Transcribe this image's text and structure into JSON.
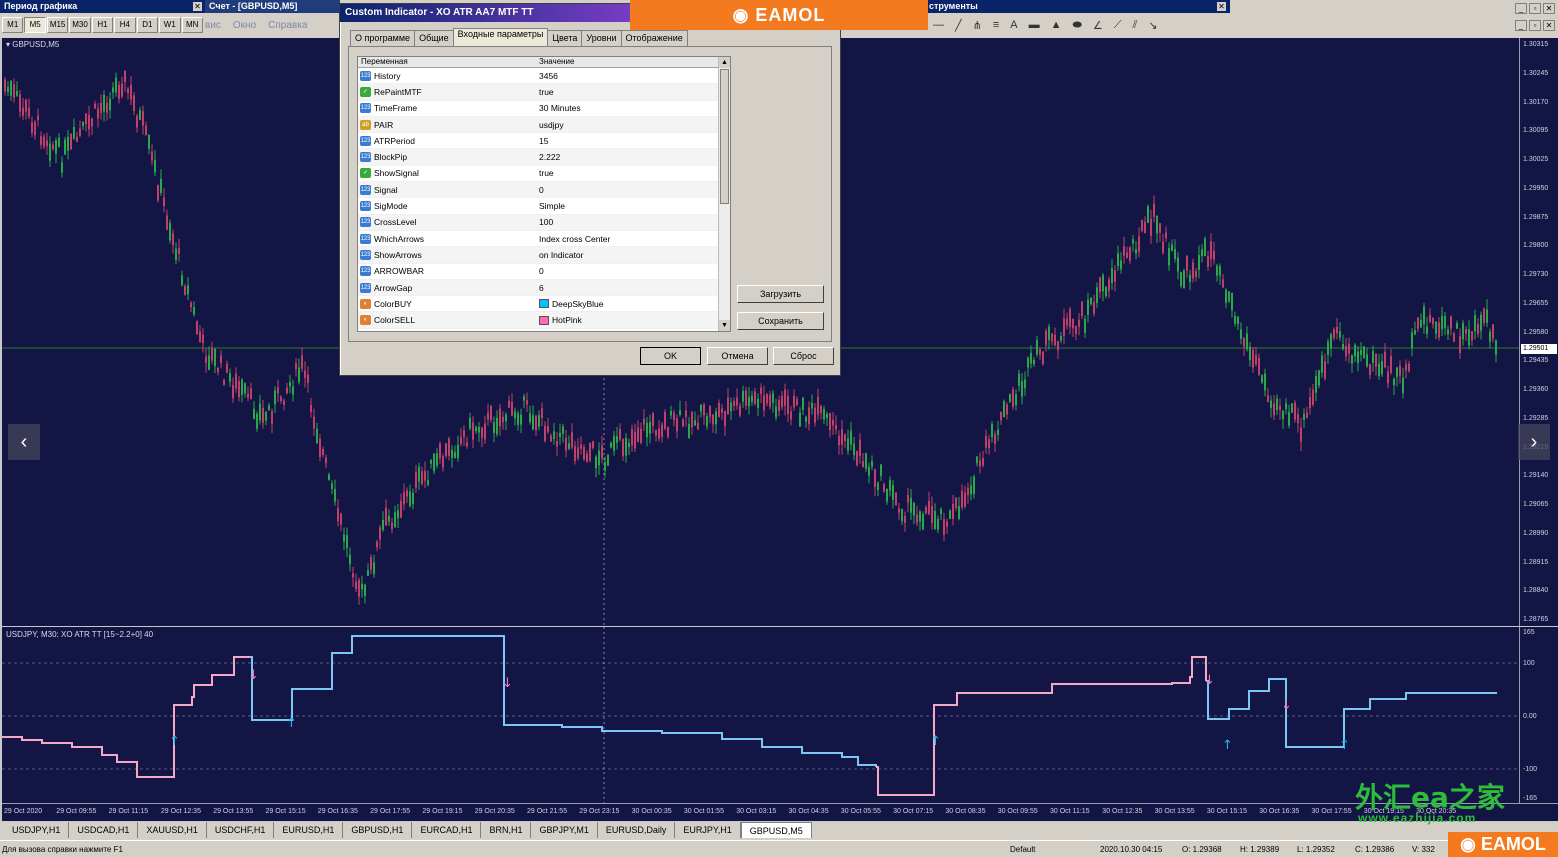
{
  "top": {
    "period_title": "Период графика",
    "chart_title": "Счет - [GBPUSD,M5]",
    "tools_title": "струменты",
    "periods": [
      "M1",
      "M5",
      "M15",
      "M30",
      "H1",
      "H4",
      "D1",
      "W1",
      "MN"
    ],
    "active_period": "M5",
    "menu": [
      "вис",
      "Окно",
      "Справка"
    ]
  },
  "chart": {
    "symbol_label": "GBPUSD,M5",
    "current_price": "1.29501",
    "price_ticks": [
      "1.30315",
      "1.30245",
      "1.30170",
      "1.30095",
      "1.30025",
      "1.29950",
      "1.29875",
      "1.29800",
      "1.29730",
      "1.29655",
      "1.29580",
      "1.29435",
      "1.29360",
      "1.29285",
      "1.29215",
      "1.29140",
      "1.29065",
      "1.28990",
      "1.28915",
      "1.28840",
      "1.28765"
    ],
    "indicator_label": "USDJPY, M30: XO ATR TT [15~2.2+0] 40",
    "ind_ticks": [
      "165",
      "100",
      "0.00",
      "-100",
      "-165"
    ],
    "time_ticks": [
      "29 Oct 2020",
      "29 Oct 09:55",
      "29 Oct 11:15",
      "29 Oct 12:35",
      "29 Oct 13:55",
      "29 Oct 15:15",
      "29 Oct 16:35",
      "29 Oct 17:55",
      "29 Oct 19:15",
      "29 Oct 20:35",
      "29 Oct 21:55",
      "29 Oct 23:15",
      "30 Oct 00:35",
      "30 Oct 01:55",
      "30 Oct 03:15",
      "30 Oct 04:35",
      "30 Oct 05:55",
      "30 Oct 07:15",
      "30 Oct 08:35",
      "30 Oct 09:55",
      "30 Oct 11:15",
      "30 Oct 12:35",
      "30 Oct 13:55",
      "30 Oct 15:15",
      "30 Oct 16:35",
      "30 Oct 17:55",
      "30 Oct 19:15",
      "30 Oct 20:35"
    ],
    "colors": {
      "bg": "#131644",
      "bull": "#2aa84a",
      "bear": "#c0406a",
      "buy": "#22b8f0",
      "sell": "#f07ab8",
      "line_up": "#7cc6f4",
      "line_dn": "#f4a8c8"
    }
  },
  "dialog": {
    "title": "Custom Indicator - XO ATR AA7 MTF TT",
    "tabs": [
      "О программе",
      "Общие",
      "Входные параметры",
      "Цвета",
      "Уровни",
      "Отображение"
    ],
    "active_tab": "Входные параметры",
    "col_var": "Переменная",
    "col_val": "Значение",
    "params": [
      {
        "name": "History",
        "value": "3456",
        "icon": "123"
      },
      {
        "name": "RePaintMTF",
        "value": "true",
        "icon": "bool"
      },
      {
        "name": "TimeFrame",
        "value": "30 Minutes",
        "icon": "123"
      },
      {
        "name": "PAIR",
        "value": "usdjpy",
        "icon": "ab"
      },
      {
        "name": "ATRPeriod",
        "value": "15",
        "icon": "123"
      },
      {
        "name": "BlockPip",
        "value": "2.222",
        "icon": "123"
      },
      {
        "name": "ShowSignal",
        "value": "true",
        "icon": "bool"
      },
      {
        "name": "Signal",
        "value": "0",
        "icon": "123"
      },
      {
        "name": "SigMode",
        "value": "Simple",
        "icon": "123"
      },
      {
        "name": "CrossLevel",
        "value": "100",
        "icon": "123"
      },
      {
        "name": "WhichArrows",
        "value": "Index cross Center",
        "icon": "123"
      },
      {
        "name": "ShowArrows",
        "value": "on Indicator",
        "icon": "123"
      },
      {
        "name": "ARROWBAR",
        "value": "0",
        "icon": "123"
      },
      {
        "name": "ArrowGap",
        "value": "6",
        "icon": "123"
      },
      {
        "name": "ColorBUY",
        "value": "DeepSkyBlue",
        "icon": "color",
        "swatch": "#00bfff"
      },
      {
        "name": "ColorSELL",
        "value": "HotPink",
        "icon": "color",
        "swatch": "#ff69b4"
      }
    ],
    "load_label": "Загрузить",
    "save_label": "Сохранить",
    "ok_label": "OK",
    "cancel_label": "Отмена",
    "reset_label": "Сброс"
  },
  "tabs": [
    "USDJPY,H1",
    "USDCAD,H1",
    "XAUUSD,H1",
    "USDCHF,H1",
    "EURUSD,H1",
    "GBPUSD,H1",
    "EURCAD,H1",
    "BRN,H1",
    "GBPJPY,M1",
    "EURUSD,Daily",
    "EURJPY,H1",
    "GBPUSD,M5"
  ],
  "active_tab": "GBPUSD,M5",
  "status": {
    "help": "Для вызова справки нажмите F1",
    "profile": "Default",
    "datetime": "2020.10.30 04:15",
    "open": "O: 1.29368",
    "high": "H: 1.29389",
    "low": "L: 1.29352",
    "close": "C: 1.29386",
    "volume": "V: 332"
  },
  "watermark": {
    "brand": "EAMOL",
    "cn": "外汇ea之家",
    "url": "www.eazhijia.com"
  }
}
